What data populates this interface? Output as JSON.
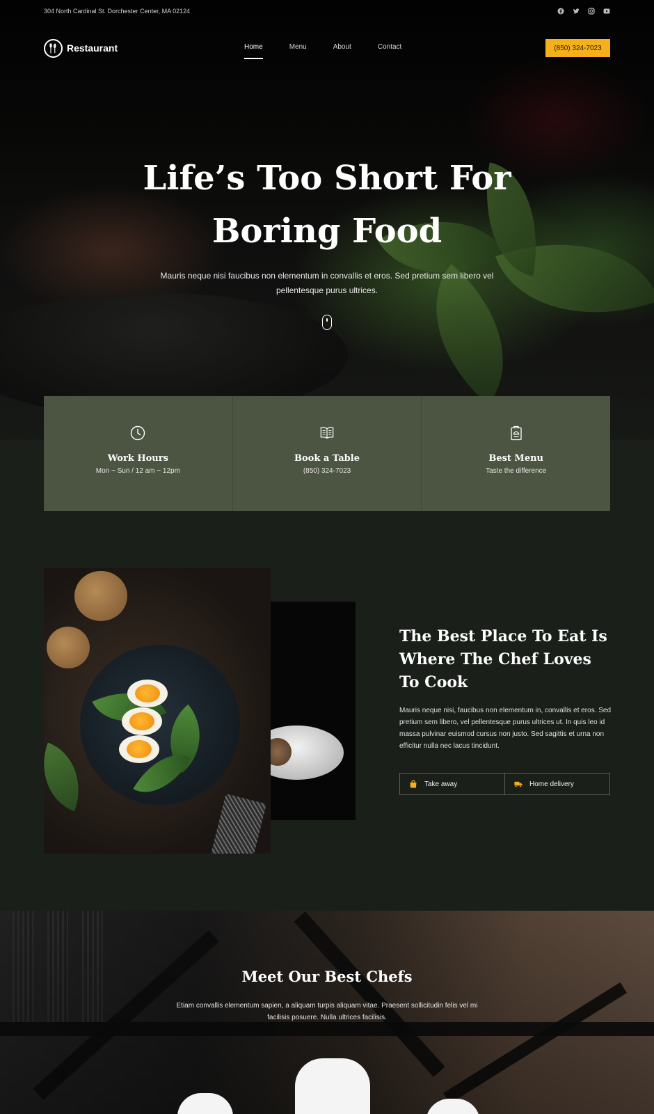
{
  "topbar": {
    "address": "304 North Cardinal St. Dorchester Center, MA 02124",
    "socials": [
      "facebook-icon",
      "twitter-icon",
      "instagram-icon",
      "youtube-icon"
    ]
  },
  "nav": {
    "brand": "Restaurant",
    "items": [
      {
        "label": "Home",
        "active": true
      },
      {
        "label": "Menu",
        "active": false
      },
      {
        "label": "About",
        "active": false
      },
      {
        "label": "Contact",
        "active": false
      }
    ],
    "phone": "(850) 324-7023"
  },
  "hero": {
    "title_line1": "Life’s Too Short For",
    "title_line2": "Boring Food",
    "subtitle": "Mauris neque nisi faucibus non elementum in convallis et eros. Sed pretium sem libero vel pellentesque purus ultrices."
  },
  "cards": [
    {
      "icon": "clock-icon",
      "title": "Work Hours",
      "text": "Mon ~ Sun / 12 am ~ 12pm"
    },
    {
      "icon": "book-icon",
      "title": "Book a Table",
      "text": "(850) 324-7023"
    },
    {
      "icon": "menu-icon",
      "title": "Best Menu",
      "text": "Taste the difference"
    }
  ],
  "about": {
    "title": "The Best Place To Eat Is Where The Chef Loves To Cook",
    "text": "Mauris neque nisi, faucibus non elementum in, convallis et eros. Sed pretium sem libero, vel pellentesque purus ultrices ut. In quis leo id massa pulvinar euismod cursus non justo. Sed sagittis et urna non efficitur nulla nec lacus tincidunt.",
    "features": [
      {
        "icon": "bag-icon",
        "label": "Take away"
      },
      {
        "icon": "truck-icon",
        "label": "Home delivery"
      }
    ]
  },
  "chefs": {
    "title": "Meet Our Best Chefs",
    "subtitle": "Etiam convallis elementum sapien, a aliquam turpis aliquam vitae. Praesent sollicitudin felis vel mi facilisis posuere. Nulla ultrices facilisis."
  },
  "colors": {
    "accent": "#f6b11a",
    "card_bg": "#4c5442",
    "section_bg": "#1a1f1a"
  }
}
